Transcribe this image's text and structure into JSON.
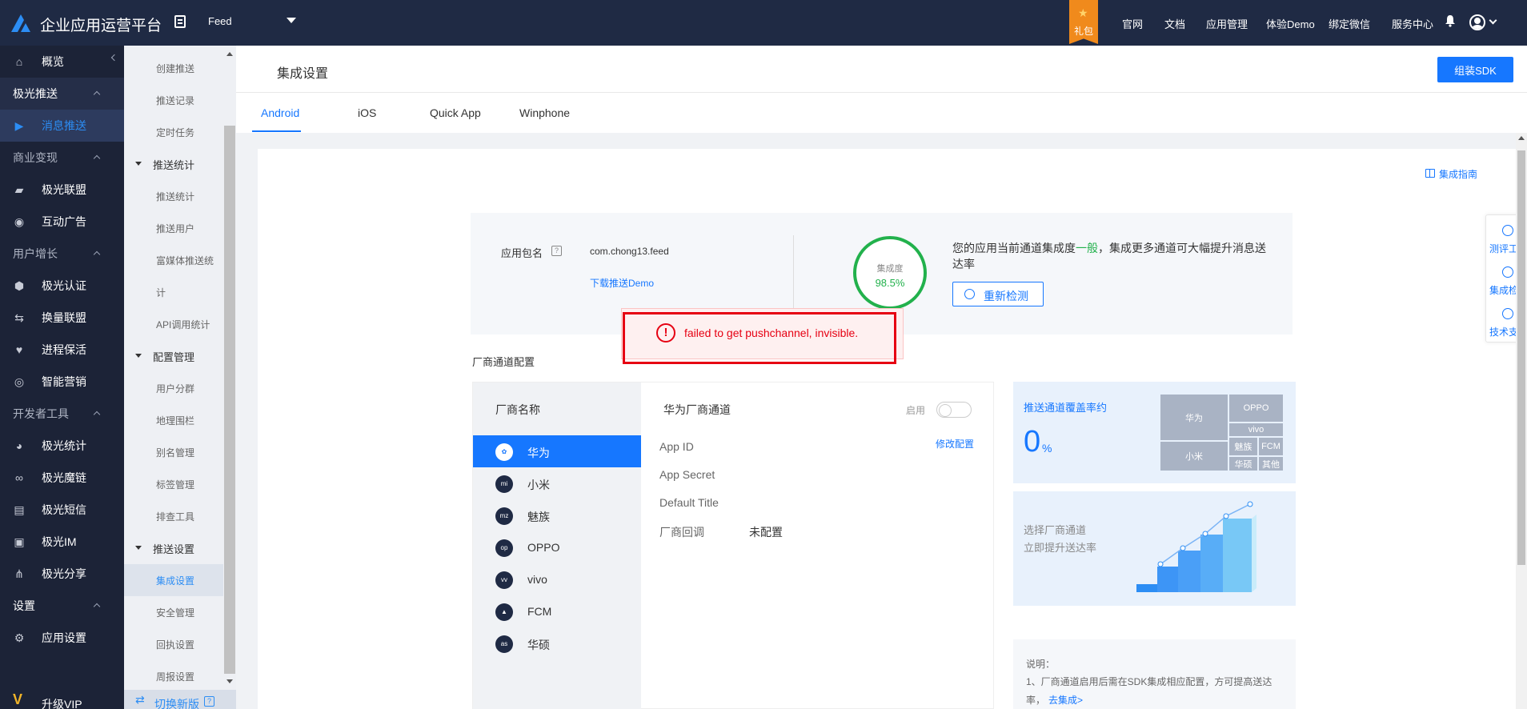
{
  "topbar": {
    "title": "企业应用运营平台",
    "app_name": "Feed",
    "gift_label": "礼包",
    "nav": [
      "官网",
      "文档",
      "应用管理",
      "体验Demo",
      "绑定微信",
      "服务中心"
    ]
  },
  "leftnav": {
    "overview": "概览",
    "groups": {
      "push": "极光推送",
      "monetize": "商业变现",
      "growth": "用户增长",
      "devtools": "开发者工具",
      "settings": "设置"
    },
    "items": {
      "message_push": "消息推送",
      "alliance": "极光联盟",
      "interactive_ads": "互动广告",
      "auth": "极光认证",
      "exchange": "换量联盟",
      "keepalive": "进程保活",
      "smart_marketing": "智能营销",
      "stats": "极光统计",
      "magic_link": "极光魔链",
      "sms": "极光短信",
      "im": "极光IM",
      "share": "极光分享",
      "app_settings": "应用设置"
    },
    "upgrade": "升级VIP"
  },
  "subnav": {
    "create_push": "创建推送",
    "push_records": "推送记录",
    "scheduled": "定时任务",
    "stats_head": "推送统计",
    "push_stats": "推送统计",
    "push_users": "推送用户",
    "rich_media_1": "富媒体推送统",
    "rich_media_2": "计",
    "api_stats": "API调用统计",
    "config_head": "配置管理",
    "segments": "用户分群",
    "geofence": "地理围栏",
    "alias": "别名管理",
    "tags": "标签管理",
    "troubleshoot": "排查工具",
    "push_settings_head": "推送设置",
    "integration": "集成设置",
    "security": "安全管理",
    "callback": "回执设置",
    "weekly": "周报设置",
    "switch_new": "切换新版"
  },
  "header": {
    "page_title": "集成设置",
    "sdk_button": "组装SDK"
  },
  "tabs": [
    "Android",
    "iOS",
    "Quick App",
    "Winphone"
  ],
  "guide_link": "集成指南",
  "app_info": {
    "pkg_label": "应用包名",
    "pkg_value": "com.chong13.feed",
    "demo_link": "下载推送Demo",
    "gauge_label": "集成度",
    "gauge_value": "98.5%",
    "gauge_value_num": 98.5,
    "rate_prefix": "您的应用当前通道集成度",
    "rate_level": "一般",
    "rate_suffix": "，集成更多通道可大幅提升消息送达率",
    "recheck": "重新检测"
  },
  "toast": {
    "message": "failed to get pushchannel, invisible."
  },
  "vendor_section": {
    "title": "厂商通道配置",
    "list_head": "厂商名称",
    "vendors": [
      {
        "name": "华为",
        "logo": "huawei-logo"
      },
      {
        "name": "小米",
        "logo": "mi-logo"
      },
      {
        "name": "魅族",
        "logo": "meizu-logo"
      },
      {
        "name": "OPPO",
        "logo": "oppo-logo"
      },
      {
        "name": "vivo",
        "logo": "vivo-logo"
      },
      {
        "name": "FCM",
        "logo": "fcm-logo"
      },
      {
        "name": "华硕",
        "logo": "asus-logo"
      }
    ],
    "selected": "华为"
  },
  "config": {
    "title": "华为厂商通道",
    "enable_label": "启用",
    "enabled": false,
    "modify": "修改配置",
    "rows": [
      {
        "label": "App ID",
        "value": ""
      },
      {
        "label": "App Secret",
        "value": ""
      },
      {
        "label": "Default Title",
        "value": ""
      },
      {
        "label": "厂商回调",
        "value": "未配置"
      }
    ]
  },
  "coverage": {
    "title": "推送通道覆盖率约",
    "value": "0",
    "unit": "%",
    "treemap": [
      "华为",
      "小米",
      "OPPO",
      "vivo",
      "魅族",
      "FCM",
      "华硕",
      "其他"
    ]
  },
  "promo": {
    "line1": "选择厂商通道",
    "line2": "立即提升送达率"
  },
  "note": {
    "title": "说明：",
    "line1": "1、厂商通道启用后需在SDK集成相应配置，方可提高送达",
    "line2": "率，",
    "link": "去集成>"
  },
  "float_tools": [
    "测评工具",
    "集成检测",
    "技术支持"
  ],
  "colors": {
    "primary": "#1677ff",
    "topbar": "#1f2a44",
    "leftnav": "#1c2337",
    "success": "#22b14c",
    "error": "#e60012",
    "gift": "#f08a1c"
  }
}
